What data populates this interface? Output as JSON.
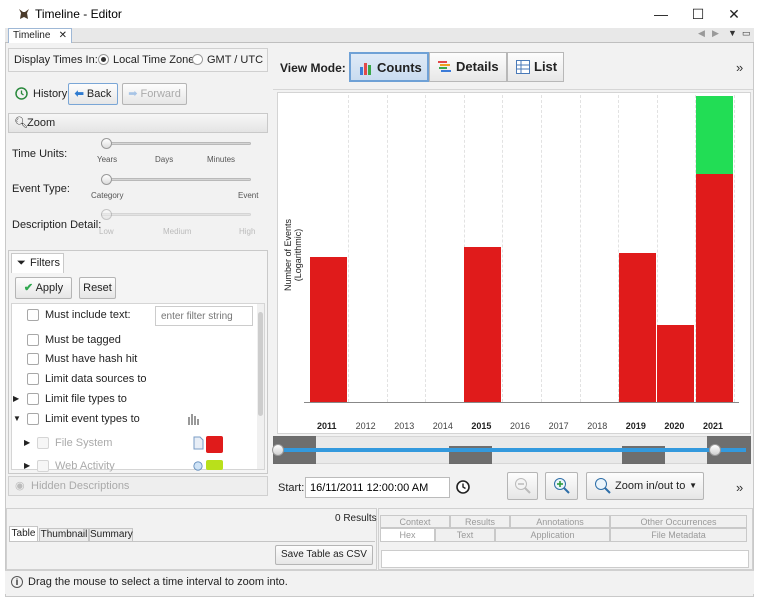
{
  "window": {
    "title": "Timeline - Editor",
    "minimize": "—",
    "maximize": "☐",
    "close": "✕"
  },
  "doc_tab": {
    "label": "Timeline",
    "close": "✕"
  },
  "display_times": {
    "label": "Display Times In:",
    "local": "Local Time Zone",
    "gmt": "GMT / UTC",
    "selected": "Local Time Zone"
  },
  "history": {
    "label": "History",
    "back": "Back",
    "forward": "Forward"
  },
  "zoom": {
    "header": "Zoom",
    "time_units": {
      "label": "Time Units:",
      "ticks": [
        "Years",
        "Days",
        "Minutes"
      ]
    },
    "event_type": {
      "label": "Event Type:",
      "ticks": [
        "Category",
        "Event"
      ]
    },
    "description_detail": {
      "label": "Description Detail:",
      "ticks": [
        "Low",
        "Medium",
        "High"
      ]
    }
  },
  "filters": {
    "header": "Filters",
    "apply": "Apply",
    "reset": "Reset",
    "placeholder": "enter filter string",
    "items": [
      "Must include text:",
      "Must be tagged",
      "Must have hash hit",
      "Limit data sources to",
      "Limit file types to",
      "Limit event types to",
      "File System",
      "Web Activity"
    ]
  },
  "hidden_descriptions": "Hidden Descriptions",
  "view_mode": {
    "label": "View Mode:",
    "counts": "Counts",
    "details": "Details",
    "list": "List",
    "selected": "Counts"
  },
  "chart_more": "»",
  "chart_data": {
    "type": "bar",
    "stacked": true,
    "log_scale": true,
    "ylabel": "Number of Events (Logarithmic)",
    "categories": [
      "2011",
      "2012",
      "2013",
      "2014",
      "2015",
      "2016",
      "2017",
      "2018",
      "2019",
      "2020",
      "2021"
    ],
    "series": [
      {
        "color": "#e01b1b",
        "values": [
          20,
          0,
          0,
          0,
          25,
          0,
          0,
          0,
          22,
          4,
          120
        ]
      },
      {
        "color": "#22dd55",
        "values": [
          0,
          0,
          0,
          0,
          0,
          0,
          0,
          0,
          0,
          0,
          500
        ]
      }
    ],
    "bold_years": [
      "2011",
      "2015",
      "2019",
      "2020",
      "2021"
    ]
  },
  "bottom_toolbar": {
    "start_label": "Start:",
    "start_value": "16/11/2011 12:00:00 AM",
    "zoom_inout": "Zoom in/out to",
    "more": "»"
  },
  "results": {
    "count_text": "0  Results",
    "tabs": [
      "Table",
      "Thumbnail",
      "Summary"
    ],
    "save_csv": "Save Table as CSV"
  },
  "content_viewer": {
    "row1": [
      "Context",
      "Results",
      "Annotations",
      "Other Occurrences"
    ],
    "row2": [
      "Hex",
      "Text",
      "Application",
      "File Metadata"
    ]
  },
  "status": "Drag the mouse to select a time interval to zoom into.",
  "colors": {
    "red": "#e01b1b",
    "green": "#22dd55",
    "accent": "#3399dd"
  }
}
